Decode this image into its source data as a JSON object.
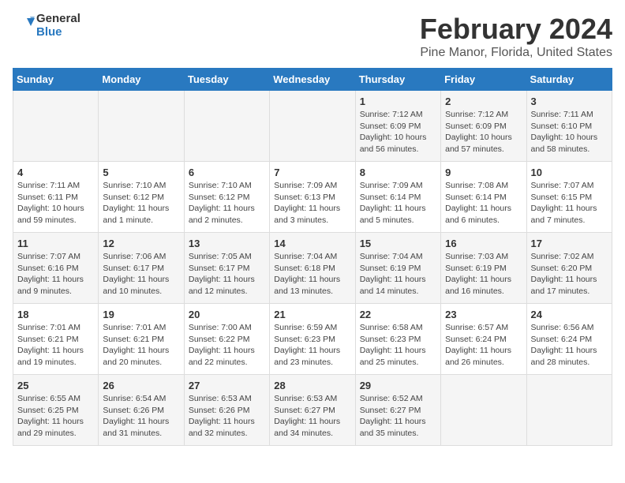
{
  "header": {
    "logo_line1": "General",
    "logo_line2": "Blue",
    "main_title": "February 2024",
    "subtitle": "Pine Manor, Florida, United States"
  },
  "days_of_week": [
    "Sunday",
    "Monday",
    "Tuesday",
    "Wednesday",
    "Thursday",
    "Friday",
    "Saturday"
  ],
  "weeks": [
    [
      {
        "day": "",
        "info": ""
      },
      {
        "day": "",
        "info": ""
      },
      {
        "day": "",
        "info": ""
      },
      {
        "day": "",
        "info": ""
      },
      {
        "day": "1",
        "info": "Sunrise: 7:12 AM\nSunset: 6:09 PM\nDaylight: 10 hours and 56 minutes."
      },
      {
        "day": "2",
        "info": "Sunrise: 7:12 AM\nSunset: 6:09 PM\nDaylight: 10 hours and 57 minutes."
      },
      {
        "day": "3",
        "info": "Sunrise: 7:11 AM\nSunset: 6:10 PM\nDaylight: 10 hours and 58 minutes."
      }
    ],
    [
      {
        "day": "4",
        "info": "Sunrise: 7:11 AM\nSunset: 6:11 PM\nDaylight: 10 hours and 59 minutes."
      },
      {
        "day": "5",
        "info": "Sunrise: 7:10 AM\nSunset: 6:12 PM\nDaylight: 11 hours and 1 minute."
      },
      {
        "day": "6",
        "info": "Sunrise: 7:10 AM\nSunset: 6:12 PM\nDaylight: 11 hours and 2 minutes."
      },
      {
        "day": "7",
        "info": "Sunrise: 7:09 AM\nSunset: 6:13 PM\nDaylight: 11 hours and 3 minutes."
      },
      {
        "day": "8",
        "info": "Sunrise: 7:09 AM\nSunset: 6:14 PM\nDaylight: 11 hours and 5 minutes."
      },
      {
        "day": "9",
        "info": "Sunrise: 7:08 AM\nSunset: 6:14 PM\nDaylight: 11 hours and 6 minutes."
      },
      {
        "day": "10",
        "info": "Sunrise: 7:07 AM\nSunset: 6:15 PM\nDaylight: 11 hours and 7 minutes."
      }
    ],
    [
      {
        "day": "11",
        "info": "Sunrise: 7:07 AM\nSunset: 6:16 PM\nDaylight: 11 hours and 9 minutes."
      },
      {
        "day": "12",
        "info": "Sunrise: 7:06 AM\nSunset: 6:17 PM\nDaylight: 11 hours and 10 minutes."
      },
      {
        "day": "13",
        "info": "Sunrise: 7:05 AM\nSunset: 6:17 PM\nDaylight: 11 hours and 12 minutes."
      },
      {
        "day": "14",
        "info": "Sunrise: 7:04 AM\nSunset: 6:18 PM\nDaylight: 11 hours and 13 minutes."
      },
      {
        "day": "15",
        "info": "Sunrise: 7:04 AM\nSunset: 6:19 PM\nDaylight: 11 hours and 14 minutes."
      },
      {
        "day": "16",
        "info": "Sunrise: 7:03 AM\nSunset: 6:19 PM\nDaylight: 11 hours and 16 minutes."
      },
      {
        "day": "17",
        "info": "Sunrise: 7:02 AM\nSunset: 6:20 PM\nDaylight: 11 hours and 17 minutes."
      }
    ],
    [
      {
        "day": "18",
        "info": "Sunrise: 7:01 AM\nSunset: 6:21 PM\nDaylight: 11 hours and 19 minutes."
      },
      {
        "day": "19",
        "info": "Sunrise: 7:01 AM\nSunset: 6:21 PM\nDaylight: 11 hours and 20 minutes."
      },
      {
        "day": "20",
        "info": "Sunrise: 7:00 AM\nSunset: 6:22 PM\nDaylight: 11 hours and 22 minutes."
      },
      {
        "day": "21",
        "info": "Sunrise: 6:59 AM\nSunset: 6:23 PM\nDaylight: 11 hours and 23 minutes."
      },
      {
        "day": "22",
        "info": "Sunrise: 6:58 AM\nSunset: 6:23 PM\nDaylight: 11 hours and 25 minutes."
      },
      {
        "day": "23",
        "info": "Sunrise: 6:57 AM\nSunset: 6:24 PM\nDaylight: 11 hours and 26 minutes."
      },
      {
        "day": "24",
        "info": "Sunrise: 6:56 AM\nSunset: 6:24 PM\nDaylight: 11 hours and 28 minutes."
      }
    ],
    [
      {
        "day": "25",
        "info": "Sunrise: 6:55 AM\nSunset: 6:25 PM\nDaylight: 11 hours and 29 minutes."
      },
      {
        "day": "26",
        "info": "Sunrise: 6:54 AM\nSunset: 6:26 PM\nDaylight: 11 hours and 31 minutes."
      },
      {
        "day": "27",
        "info": "Sunrise: 6:53 AM\nSunset: 6:26 PM\nDaylight: 11 hours and 32 minutes."
      },
      {
        "day": "28",
        "info": "Sunrise: 6:53 AM\nSunset: 6:27 PM\nDaylight: 11 hours and 34 minutes."
      },
      {
        "day": "29",
        "info": "Sunrise: 6:52 AM\nSunset: 6:27 PM\nDaylight: 11 hours and 35 minutes."
      },
      {
        "day": "",
        "info": ""
      },
      {
        "day": "",
        "info": ""
      }
    ]
  ]
}
